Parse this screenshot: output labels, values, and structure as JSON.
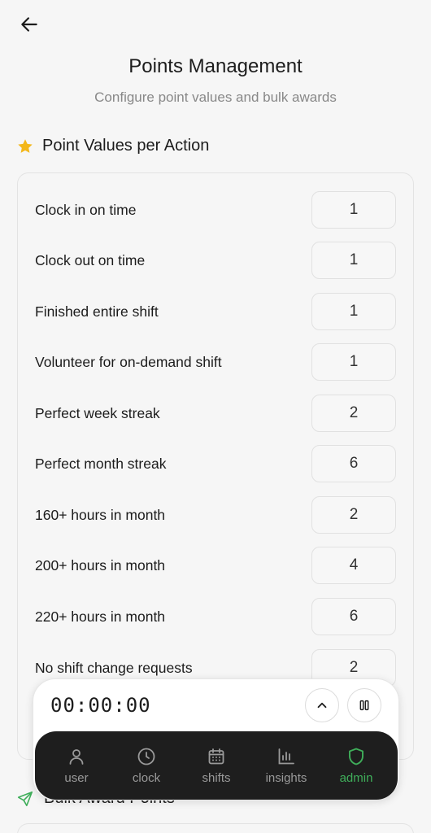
{
  "header": {
    "title": "Points Management",
    "subtitle": "Configure point values and bulk awards"
  },
  "point_values": {
    "section_title": "Point Values per Action",
    "icon": "star-icon",
    "star_color": "#f3b71a",
    "rows": [
      {
        "label": "Clock in on time",
        "value": "1"
      },
      {
        "label": "Clock out on time",
        "value": "1"
      },
      {
        "label": "Finished entire shift",
        "value": "1"
      },
      {
        "label": "Volunteer for on-demand shift",
        "value": "1"
      },
      {
        "label": "Perfect week streak",
        "value": "2"
      },
      {
        "label": "Perfect month streak",
        "value": "6"
      },
      {
        "label": "160+ hours in month",
        "value": "2"
      },
      {
        "label": "200+ hours in month",
        "value": "4"
      },
      {
        "label": "220+ hours in month",
        "value": "6"
      },
      {
        "label": "No shift change requests",
        "value": "2"
      }
    ]
  },
  "bulk_award": {
    "section_title": "Bulk Award Points",
    "icon": "send-icon",
    "icon_color": "#3fae5a"
  },
  "timer": {
    "display": "00:00:00"
  },
  "nav": {
    "active_color": "#3fae5a",
    "items": [
      {
        "label": "user",
        "icon": "user-icon"
      },
      {
        "label": "clock",
        "icon": "clock-icon"
      },
      {
        "label": "shifts",
        "icon": "calendar-icon"
      },
      {
        "label": "insights",
        "icon": "bar-chart-icon"
      },
      {
        "label": "admin",
        "icon": "shield-icon",
        "active": true
      }
    ]
  }
}
